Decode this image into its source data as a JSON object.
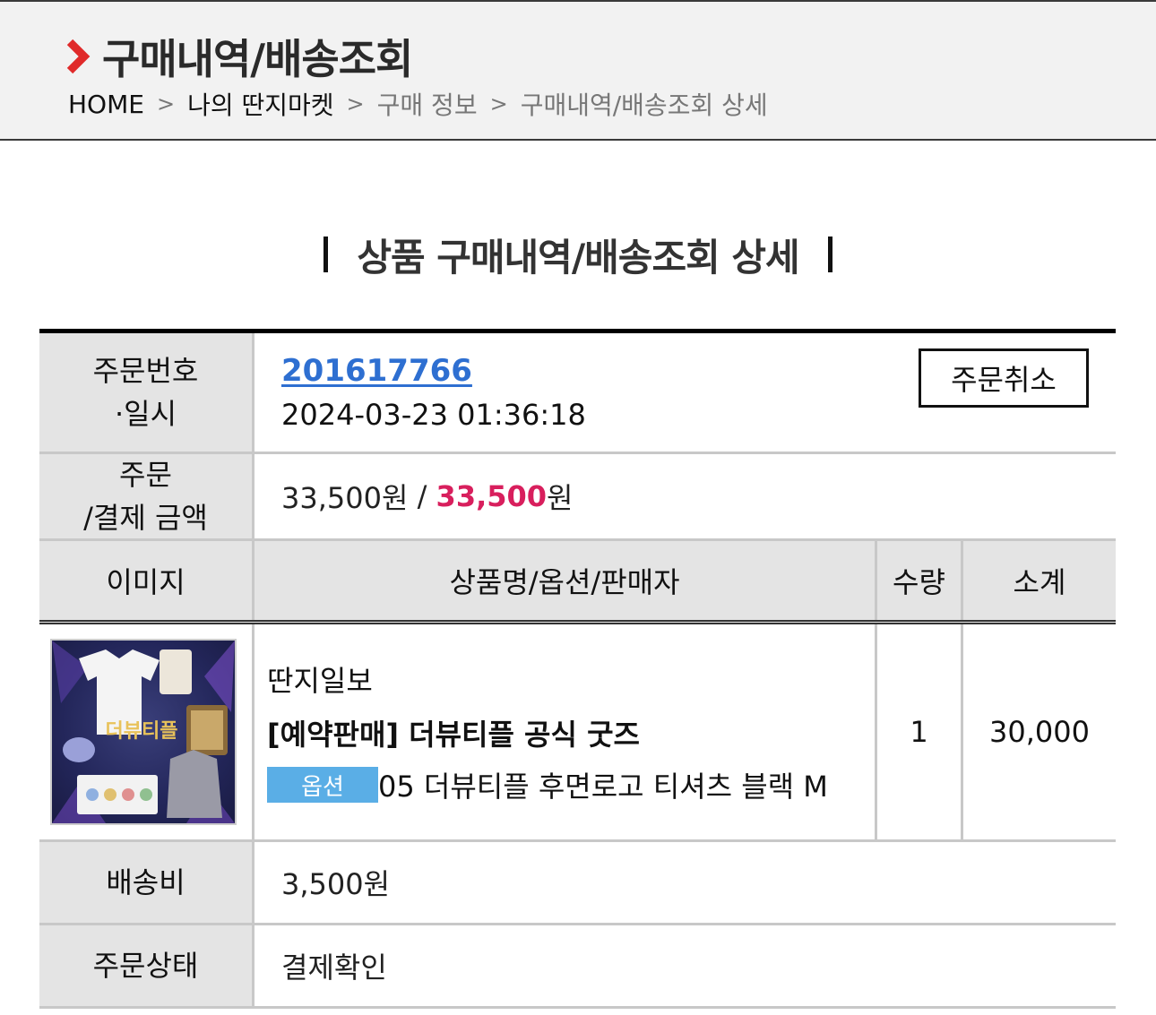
{
  "header": {
    "title": "구매내역/배송조회",
    "breadcrumbs": [
      "HOME",
      "나의 딴지마켓",
      "구매 정보",
      "구매내역/배송조회 상세"
    ],
    "crumb_separator": ">"
  },
  "section_title": "상품 구매내역/배송조회 상세",
  "order": {
    "label_line1": "주문번호",
    "label_line2": "·일시",
    "number": "201617766",
    "datetime": "2024-03-23 01:36:18",
    "cancel_label": "주문취소"
  },
  "amount": {
    "label_line1": "주문",
    "label_line2": "/결제 금액",
    "order_amount": "33,500원",
    "sep": " / ",
    "paid_number": "33,500",
    "paid_unit": "원"
  },
  "items_table": {
    "headers": [
      "이미지",
      "상품명/옵션/판매자",
      "수량",
      "소계"
    ],
    "rows": [
      {
        "seller": "딴지일보",
        "name": "[예약판매] 더뷰티플 공식 굿즈",
        "option_badge": "옵션",
        "option": "05 더뷰티플 후면로고 티셔츠 블랙 M",
        "qty": "1",
        "subtotal": "30,000"
      }
    ]
  },
  "shipping": {
    "label": "배송비",
    "value": "3,500원"
  },
  "status": {
    "label": "주문상태",
    "value": "결제확인"
  },
  "colors": {
    "accent_red": "#d81f5d",
    "link_blue": "#2e6fd1",
    "badge_blue": "#5aaee6",
    "chevron_red": "#e02a2a"
  }
}
